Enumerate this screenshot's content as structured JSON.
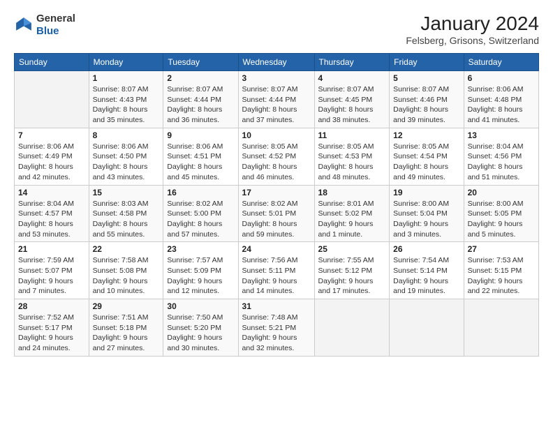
{
  "header": {
    "logo_general": "General",
    "logo_blue": "Blue",
    "title": "January 2024",
    "subtitle": "Felsberg, Grisons, Switzerland"
  },
  "calendar": {
    "days_of_week": [
      "Sunday",
      "Monday",
      "Tuesday",
      "Wednesday",
      "Thursday",
      "Friday",
      "Saturday"
    ],
    "weeks": [
      [
        {
          "num": "",
          "detail": ""
        },
        {
          "num": "1",
          "detail": "Sunrise: 8:07 AM\nSunset: 4:43 PM\nDaylight: 8 hours\nand 35 minutes."
        },
        {
          "num": "2",
          "detail": "Sunrise: 8:07 AM\nSunset: 4:44 PM\nDaylight: 8 hours\nand 36 minutes."
        },
        {
          "num": "3",
          "detail": "Sunrise: 8:07 AM\nSunset: 4:44 PM\nDaylight: 8 hours\nand 37 minutes."
        },
        {
          "num": "4",
          "detail": "Sunrise: 8:07 AM\nSunset: 4:45 PM\nDaylight: 8 hours\nand 38 minutes."
        },
        {
          "num": "5",
          "detail": "Sunrise: 8:07 AM\nSunset: 4:46 PM\nDaylight: 8 hours\nand 39 minutes."
        },
        {
          "num": "6",
          "detail": "Sunrise: 8:06 AM\nSunset: 4:48 PM\nDaylight: 8 hours\nand 41 minutes."
        }
      ],
      [
        {
          "num": "7",
          "detail": "Sunrise: 8:06 AM\nSunset: 4:49 PM\nDaylight: 8 hours\nand 42 minutes."
        },
        {
          "num": "8",
          "detail": "Sunrise: 8:06 AM\nSunset: 4:50 PM\nDaylight: 8 hours\nand 43 minutes."
        },
        {
          "num": "9",
          "detail": "Sunrise: 8:06 AM\nSunset: 4:51 PM\nDaylight: 8 hours\nand 45 minutes."
        },
        {
          "num": "10",
          "detail": "Sunrise: 8:05 AM\nSunset: 4:52 PM\nDaylight: 8 hours\nand 46 minutes."
        },
        {
          "num": "11",
          "detail": "Sunrise: 8:05 AM\nSunset: 4:53 PM\nDaylight: 8 hours\nand 48 minutes."
        },
        {
          "num": "12",
          "detail": "Sunrise: 8:05 AM\nSunset: 4:54 PM\nDaylight: 8 hours\nand 49 minutes."
        },
        {
          "num": "13",
          "detail": "Sunrise: 8:04 AM\nSunset: 4:56 PM\nDaylight: 8 hours\nand 51 minutes."
        }
      ],
      [
        {
          "num": "14",
          "detail": "Sunrise: 8:04 AM\nSunset: 4:57 PM\nDaylight: 8 hours\nand 53 minutes."
        },
        {
          "num": "15",
          "detail": "Sunrise: 8:03 AM\nSunset: 4:58 PM\nDaylight: 8 hours\nand 55 minutes."
        },
        {
          "num": "16",
          "detail": "Sunrise: 8:02 AM\nSunset: 5:00 PM\nDaylight: 8 hours\nand 57 minutes."
        },
        {
          "num": "17",
          "detail": "Sunrise: 8:02 AM\nSunset: 5:01 PM\nDaylight: 8 hours\nand 59 minutes."
        },
        {
          "num": "18",
          "detail": "Sunrise: 8:01 AM\nSunset: 5:02 PM\nDaylight: 9 hours\nand 1 minute."
        },
        {
          "num": "19",
          "detail": "Sunrise: 8:00 AM\nSunset: 5:04 PM\nDaylight: 9 hours\nand 3 minutes."
        },
        {
          "num": "20",
          "detail": "Sunrise: 8:00 AM\nSunset: 5:05 PM\nDaylight: 9 hours\nand 5 minutes."
        }
      ],
      [
        {
          "num": "21",
          "detail": "Sunrise: 7:59 AM\nSunset: 5:07 PM\nDaylight: 9 hours\nand 7 minutes."
        },
        {
          "num": "22",
          "detail": "Sunrise: 7:58 AM\nSunset: 5:08 PM\nDaylight: 9 hours\nand 10 minutes."
        },
        {
          "num": "23",
          "detail": "Sunrise: 7:57 AM\nSunset: 5:09 PM\nDaylight: 9 hours\nand 12 minutes."
        },
        {
          "num": "24",
          "detail": "Sunrise: 7:56 AM\nSunset: 5:11 PM\nDaylight: 9 hours\nand 14 minutes."
        },
        {
          "num": "25",
          "detail": "Sunrise: 7:55 AM\nSunset: 5:12 PM\nDaylight: 9 hours\nand 17 minutes."
        },
        {
          "num": "26",
          "detail": "Sunrise: 7:54 AM\nSunset: 5:14 PM\nDaylight: 9 hours\nand 19 minutes."
        },
        {
          "num": "27",
          "detail": "Sunrise: 7:53 AM\nSunset: 5:15 PM\nDaylight: 9 hours\nand 22 minutes."
        }
      ],
      [
        {
          "num": "28",
          "detail": "Sunrise: 7:52 AM\nSunset: 5:17 PM\nDaylight: 9 hours\nand 24 minutes."
        },
        {
          "num": "29",
          "detail": "Sunrise: 7:51 AM\nSunset: 5:18 PM\nDaylight: 9 hours\nand 27 minutes."
        },
        {
          "num": "30",
          "detail": "Sunrise: 7:50 AM\nSunset: 5:20 PM\nDaylight: 9 hours\nand 30 minutes."
        },
        {
          "num": "31",
          "detail": "Sunrise: 7:48 AM\nSunset: 5:21 PM\nDaylight: 9 hours\nand 32 minutes."
        },
        {
          "num": "",
          "detail": ""
        },
        {
          "num": "",
          "detail": ""
        },
        {
          "num": "",
          "detail": ""
        }
      ]
    ]
  }
}
